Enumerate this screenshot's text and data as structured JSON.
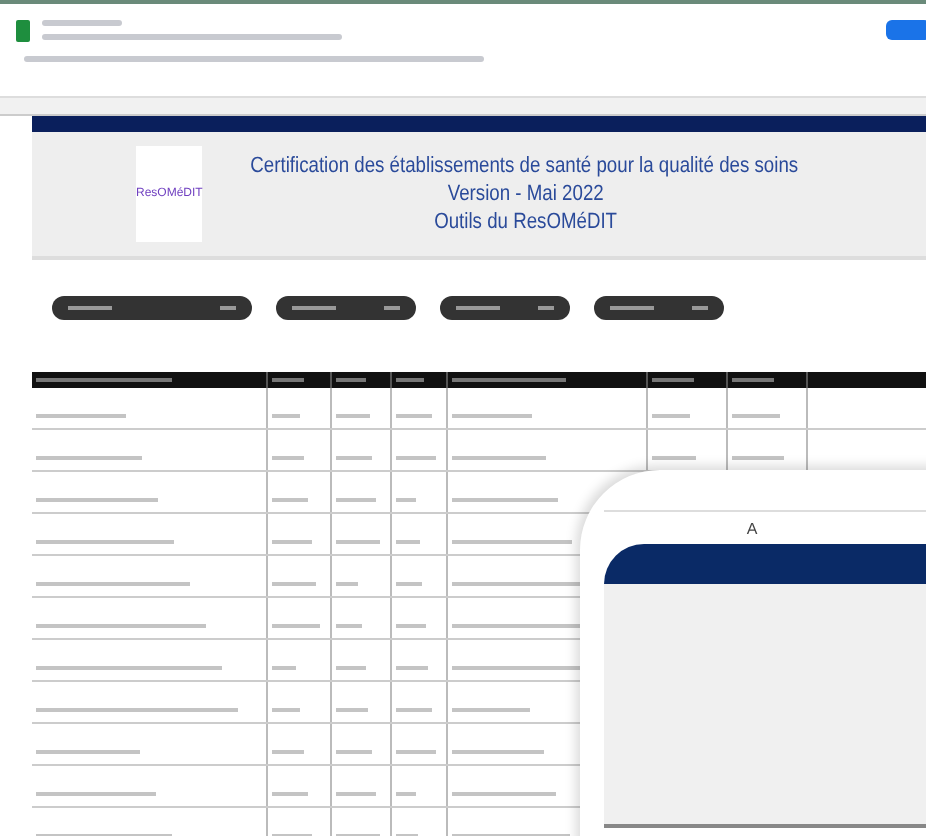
{
  "header": {
    "logo": "ResOMéDIT",
    "title_lines": [
      "Certification des établissements de santé pour la qualité des soins",
      "Version - Mai 2022",
      "Outils du ResOMéDIT"
    ]
  },
  "filters": [
    {
      "kind": "chip"
    },
    {
      "kind": "chip"
    },
    {
      "kind": "chip"
    },
    {
      "kind": "chip"
    }
  ],
  "zoom_panel": {
    "column": "A"
  }
}
